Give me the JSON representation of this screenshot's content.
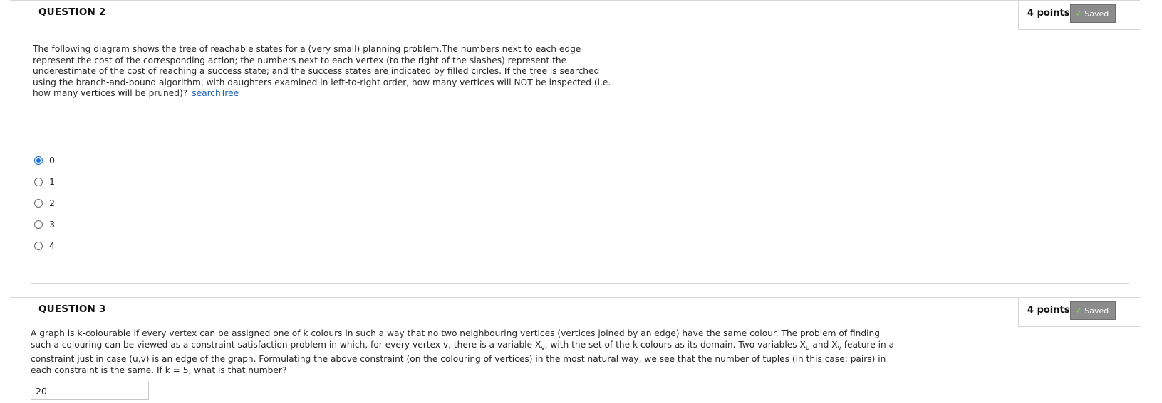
{
  "question2": {
    "title": "QUESTION 2",
    "points": "4 points",
    "saved_label": "Saved",
    "text": "The following diagram shows the tree of reachable states for a (very small) planning problem.The numbers next to each edge represent the cost of the corresponding action; the numbers next to each vertex (to the right of the slashes) represent the underestimate of the cost of reaching a success state; and the success states are indicated by filled circles. If the tree is searched using the branch-and-bound algorithm, with daughters examined in left-to-right order, how many vertices will NOT be inspected (i.e. how many vertices will be pruned)?",
    "link_text": "searchTree",
    "options": [
      "0",
      "1",
      "2",
      "3",
      "4"
    ],
    "selected_option": "0"
  },
  "question3": {
    "title": "QUESTION 3",
    "points": "4 points",
    "saved_label": "Saved",
    "text_part1": "A graph is k-colourable if every vertex can be assigned one of k colours in such a way that no two neighbouring vertices (vertices joined by an edge) have the same colour. The problem of finding such a colouring can be viewed as a constraint satisfaction problem in which, for every vertex v, there is a variable X",
    "sub_v1": "v",
    "text_part2": ", with the set of the k colours as its domain. Two variables X",
    "sub_u": "u",
    "text_part3": " and X",
    "sub_v2": "v",
    "text_part4": " feature in a constraint just in case (u,v) is an edge of the graph. Formulating the above constraint (on the colouring of vertices) in the most natural way, we see that the number of tuples (in this case: pairs) in each constraint is the same. If k = 5, what is that number?",
    "answer_value": "20"
  },
  "icons": {
    "saved": "check-icon"
  },
  "colors": {
    "saved_badge": "#8c8c8c",
    "radio_selected": "#1a6fd1",
    "link": "#1a5fb4"
  }
}
